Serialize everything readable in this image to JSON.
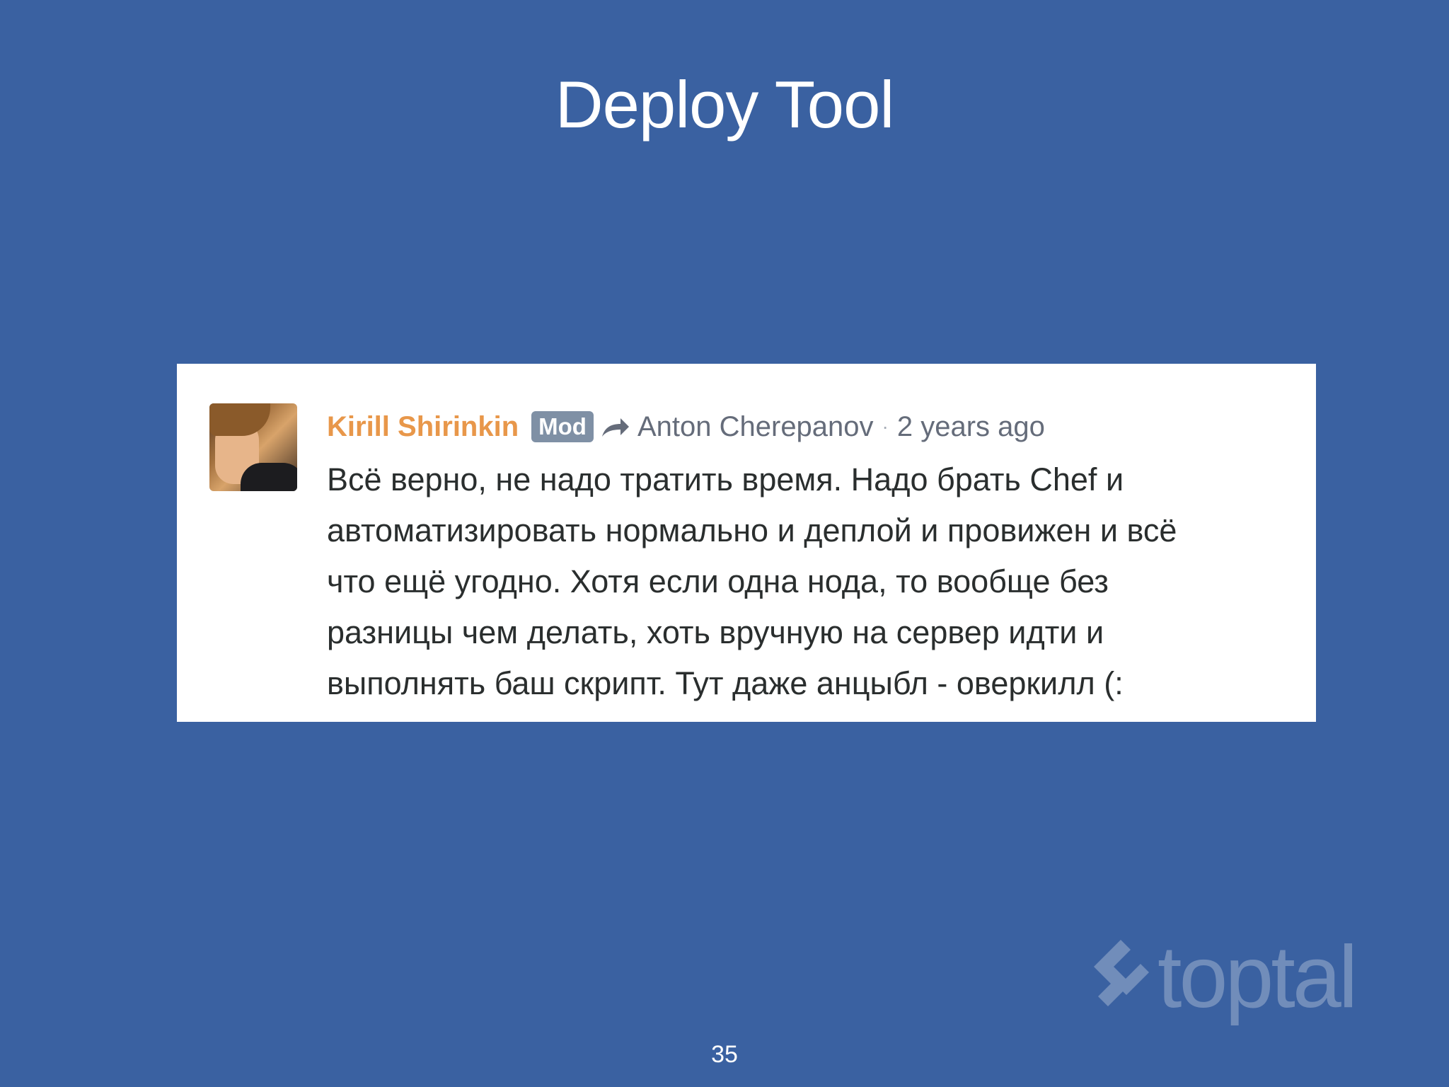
{
  "slide": {
    "title": "Deploy Tool",
    "page_number": "35"
  },
  "comment": {
    "author": "Kirill Shirinkin",
    "badge": "Mod",
    "reply_to": "Anton Cherepanov",
    "separator": "·",
    "timestamp": "2 years ago",
    "lines": [
      "Всё верно, не надо тратить время. Надо брать Chef и",
      "автоматизировать нормально и деплой и провижен и всё",
      "что ещё угодно. Хотя если одна нода, то вообще без",
      "разницы чем делать, хоть вручную на сервер идти и",
      "выполнять баш скрипт. Тут даже анцыбл - оверкилл (:"
    ]
  },
  "logo": {
    "wordmark": "toptal"
  },
  "colors": {
    "background": "#3a61a1",
    "author_name": "#e8974a",
    "badge": "#7f90a5"
  }
}
